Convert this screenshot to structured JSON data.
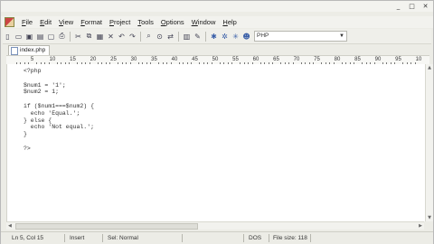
{
  "app": {
    "window_controls": [
      "_",
      "□",
      "✕"
    ]
  },
  "menu": {
    "items": [
      {
        "label": "File",
        "mnemonic": "F",
        "rest": "ile"
      },
      {
        "label": "Edit",
        "mnemonic": "E",
        "rest": "dit"
      },
      {
        "label": "View",
        "mnemonic": "V",
        "rest": "iew"
      },
      {
        "label": "Format",
        "mnemonic": "F",
        "rest": "ormat"
      },
      {
        "label": "Project",
        "mnemonic": "P",
        "rest": "roject"
      },
      {
        "label": "Tools",
        "mnemonic": "T",
        "rest": "ools"
      },
      {
        "label": "Options",
        "mnemonic": "O",
        "rest": "ptions"
      },
      {
        "label": "Window",
        "mnemonic": "W",
        "rest": "indow"
      },
      {
        "label": "Help",
        "mnemonic": "H",
        "rest": "elp"
      }
    ]
  },
  "toolbar": {
    "buttons": [
      {
        "icon": "new-file-icon",
        "glyph": "▯"
      },
      {
        "icon": "open-file-icon",
        "glyph": "▭"
      },
      {
        "icon": "save-icon",
        "glyph": "▣"
      },
      {
        "icon": "save-all-icon",
        "glyph": "▤"
      },
      {
        "icon": "close-file-icon",
        "glyph": "▢"
      },
      {
        "icon": "print-icon",
        "glyph": "⎙"
      },
      {
        "icon": "sep"
      },
      {
        "icon": "cut-icon",
        "glyph": "✂"
      },
      {
        "icon": "copy-icon",
        "glyph": "⧉"
      },
      {
        "icon": "paste-icon",
        "glyph": "▦"
      },
      {
        "icon": "delete-icon",
        "glyph": "✕"
      },
      {
        "icon": "undo-icon",
        "glyph": "↶"
      },
      {
        "icon": "redo-icon",
        "glyph": "↷"
      },
      {
        "icon": "sep"
      },
      {
        "icon": "find-icon",
        "glyph": "⌕"
      },
      {
        "icon": "find-next-icon",
        "glyph": "⊙"
      },
      {
        "icon": "replace-icon",
        "glyph": "⇄"
      },
      {
        "icon": "sep"
      },
      {
        "icon": "word-wrap-icon",
        "glyph": "▥"
      },
      {
        "icon": "spell-check-icon",
        "glyph": "✎"
      },
      {
        "icon": "sep"
      },
      {
        "icon": "run-icon",
        "glyph": "✱"
      },
      {
        "icon": "run-browser-icon",
        "glyph": "✲"
      },
      {
        "icon": "project-icon",
        "glyph": "✳"
      },
      {
        "icon": "users-icon",
        "glyph": "☻"
      }
    ],
    "language_select": "PHP"
  },
  "tabs": [
    {
      "label": "index.php"
    }
  ],
  "ruler": {
    "labels": [
      "5",
      "10",
      "15",
      "20",
      "25",
      "30",
      "35",
      "40",
      "45",
      "50",
      "55",
      "60",
      "65",
      "70",
      "75",
      "80",
      "85",
      "90",
      "95",
      "10"
    ]
  },
  "editor": {
    "lines": [
      "<?php",
      "",
      "$num1 = '1';",
      "$num2 = 1;",
      "",
      "if ($num1===$num2) {",
      "  echo 'Equal.';",
      "} else {",
      "  echo 'Not equal.';",
      "}",
      "",
      "?>"
    ]
  },
  "status": {
    "position": "Ln 5, Col 15",
    "mode": "Insert",
    "selection": "Sel: Normal",
    "line_ending": "DOS",
    "file_size": "File size: 118"
  }
}
